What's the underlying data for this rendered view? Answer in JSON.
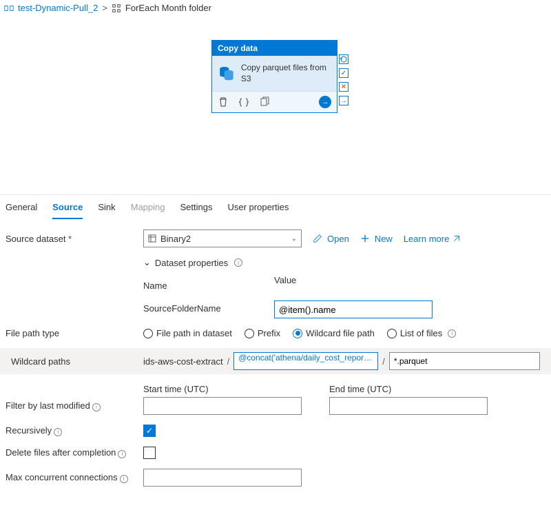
{
  "breadcrumb": {
    "parent": "test-Dynamic-Pull_2",
    "current": "ForEach Month folder"
  },
  "node": {
    "header": "Copy data",
    "body_text": "Copy parquet files from S3"
  },
  "tabs": {
    "general": "General",
    "source": "Source",
    "sink": "Sink",
    "mapping": "Mapping",
    "settings": "Settings",
    "user_props": "User properties"
  },
  "labels": {
    "source_dataset": "Source dataset",
    "dataset_properties": "Dataset properties",
    "name": "Name",
    "value": "Value",
    "file_path_type": "File path type",
    "wildcard_paths": "Wildcard paths",
    "start_time": "Start time (UTC)",
    "end_time": "End time (UTC)",
    "filter_by_last_modified": "Filter by last modified",
    "recursively": "Recursively",
    "delete_after": "Delete files after completion",
    "max_concurrent": "Max concurrent connections"
  },
  "dataset": {
    "selected": "Binary2",
    "open": "Open",
    "new": "New",
    "learn_more": "Learn more"
  },
  "props": {
    "name": "SourceFolderName",
    "value": "@item().name"
  },
  "file_path_type": {
    "opt1": "File path in dataset",
    "opt2": "Prefix",
    "opt3": "Wildcard file path",
    "opt4": "List of files"
  },
  "wildcard": {
    "container": "ids-aws-cost-extract",
    "folder": "@concat('athena/daily_cost_report/dai...",
    "file": "*.parquet"
  }
}
